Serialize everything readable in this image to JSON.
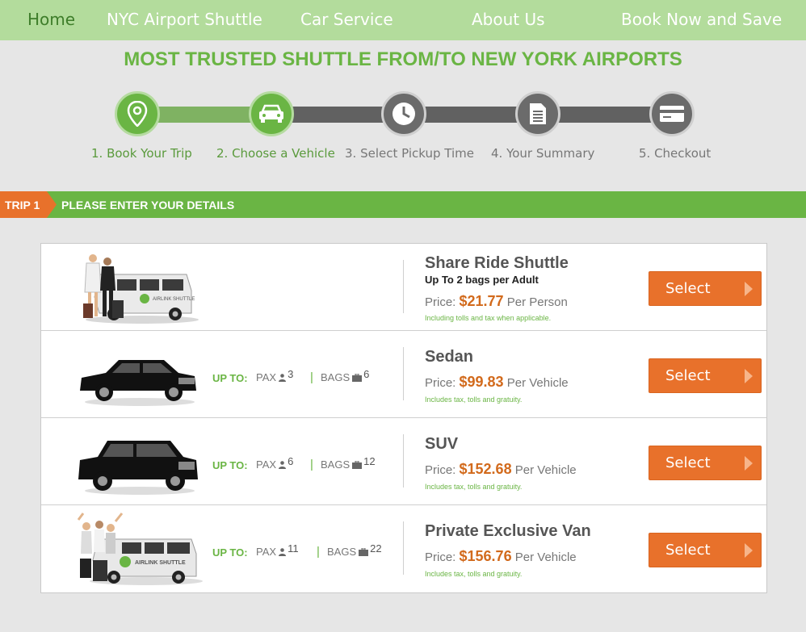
{
  "nav": {
    "home": "Home",
    "shuttle": "NYC Airport Shuttle",
    "car_service": "Car Service",
    "about": "About Us",
    "book": "Book Now and Save"
  },
  "headline": "MOST TRUSTED SHUTTLE FROM/TO NEW YORK AIRPORTS",
  "steps": [
    {
      "label": "1. Book Your Trip",
      "icon": "map-pin-icon",
      "state": "done"
    },
    {
      "label": "2. Choose a Vehicle",
      "icon": "car-icon",
      "state": "current"
    },
    {
      "label": "3. Select Pickup Time",
      "icon": "clock-icon",
      "state": "todo"
    },
    {
      "label": "4. Your Summary",
      "icon": "document-icon",
      "state": "todo"
    },
    {
      "label": "5. Checkout",
      "icon": "credit-card-icon",
      "state": "todo"
    }
  ],
  "trip": {
    "tag": "TRIP 1",
    "title": "PLEASE ENTER YOUR DETAILS"
  },
  "vehicles": [
    {
      "name": "Share Ride Shuttle",
      "subtitle": "Up To 2 bags per Adult",
      "price_prefix": "Price:",
      "price": "$21.77",
      "price_unit": "Per Person",
      "note": "Including tolls and tax when applicable.",
      "select_label": "Select",
      "image": "shuttle-van-with-people"
    },
    {
      "name": "Sedan",
      "up_to": "UP TO:",
      "pax_label": "PAX",
      "pax": "3",
      "bags_label": "BAGS",
      "bags": "6",
      "price_prefix": "Price:",
      "price": "$99.83",
      "price_unit": "Per Vehicle",
      "note": "Includes tax, tolls and gratuity.",
      "select_label": "Select",
      "image": "black-sedan"
    },
    {
      "name": "SUV",
      "up_to": "UP TO:",
      "pax_label": "PAX",
      "pax": "6",
      "bags_label": "BAGS",
      "bags": "12",
      "price_prefix": "Price:",
      "price": "$152.68",
      "price_unit": "Per Vehicle",
      "note": "Includes tax, tolls and gratuity.",
      "select_label": "Select",
      "image": "black-suv"
    },
    {
      "name": "Private Exclusive Van",
      "up_to": "UP TO:",
      "pax_label": "PAX",
      "pax": "11",
      "bags_label": "BAGS",
      "bags": "22",
      "price_prefix": "Price:",
      "price": "$156.76",
      "price_unit": "Per Vehicle",
      "note": "Includes tax, tolls and gratuity.",
      "select_label": "Select",
      "image": "private-van-with-family"
    }
  ],
  "van_logo_text": "AIRLINK SHUTTLE",
  "colors": {
    "nav_bg": "#b3dc9c",
    "brand_green": "#6ab544",
    "brand_orange": "#e8712b",
    "price_orange": "#d26a1c",
    "step_gray": "#6b6b6b"
  }
}
